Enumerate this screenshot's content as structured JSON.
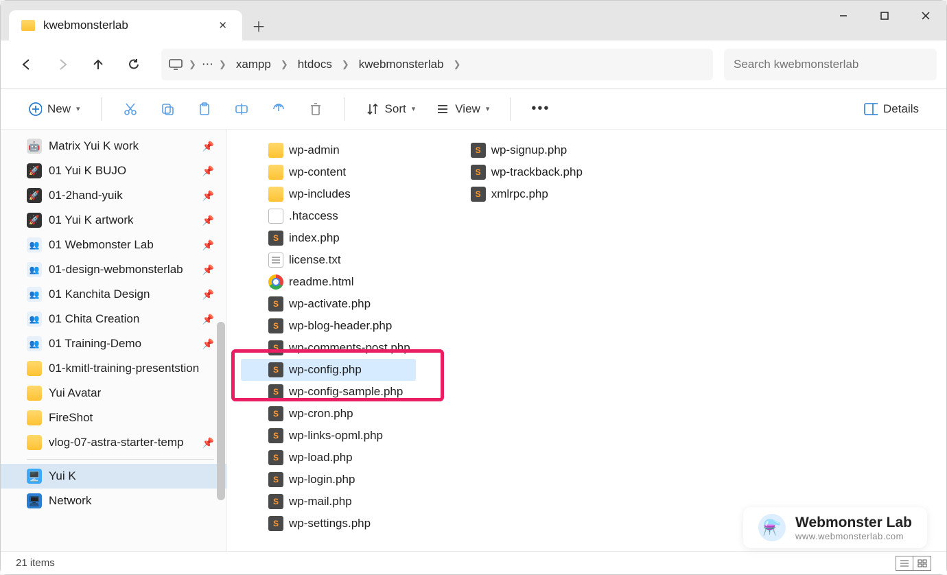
{
  "tab": {
    "title": "kwebmonsterlab"
  },
  "breadcrumb": {
    "segments": [
      "xampp",
      "htdocs",
      "kwebmonsterlab"
    ]
  },
  "search": {
    "placeholder": "Search kwebmonsterlab"
  },
  "toolbar": {
    "new_label": "New",
    "sort_label": "Sort",
    "view_label": "View",
    "details_label": "Details"
  },
  "sidebar": {
    "items": [
      {
        "label": "Matrix Yui K work",
        "icon": "robot",
        "pinned": true
      },
      {
        "label": "01 Yui K BUJO",
        "icon": "rocket",
        "pinned": true
      },
      {
        "label": "01-2hand-yuik",
        "icon": "rocket",
        "pinned": true
      },
      {
        "label": "01 Yui K artwork",
        "icon": "rocket",
        "pinned": true
      },
      {
        "label": "01 Webmonster Lab",
        "icon": "pal",
        "pinned": true
      },
      {
        "label": "01-design-webmonsterlab",
        "icon": "pal",
        "pinned": true
      },
      {
        "label": "01 Kanchita Design",
        "icon": "pal",
        "pinned": true
      },
      {
        "label": "01 Chita Creation",
        "icon": "pal",
        "pinned": true
      },
      {
        "label": "01 Training-Demo",
        "icon": "pal",
        "pinned": true
      },
      {
        "label": "01-kmitl-training-presentstion",
        "icon": "folder",
        "pinned": false
      },
      {
        "label": "Yui Avatar",
        "icon": "folder",
        "pinned": false
      },
      {
        "label": "FireShot",
        "icon": "folder",
        "pinned": false
      },
      {
        "label": "vlog-07-astra-starter-temp",
        "icon": "folder",
        "pinned": true
      }
    ],
    "bottom": [
      {
        "label": "Yui K",
        "icon": "pc",
        "active": true
      },
      {
        "label": "Network",
        "icon": "net",
        "active": false
      }
    ]
  },
  "files": {
    "col1": [
      {
        "name": "wp-admin",
        "type": "folder"
      },
      {
        "name": "wp-content",
        "type": "folder"
      },
      {
        "name": "wp-includes",
        "type": "folder"
      },
      {
        "name": ".htaccess",
        "type": "file"
      },
      {
        "name": "index.php",
        "type": "subl"
      },
      {
        "name": "license.txt",
        "type": "txt"
      },
      {
        "name": "readme.html",
        "type": "chrome"
      },
      {
        "name": "wp-activate.php",
        "type": "subl"
      },
      {
        "name": "wp-blog-header.php",
        "type": "subl"
      },
      {
        "name": "wp-comments-post.php",
        "type": "subl"
      },
      {
        "name": "wp-config.php",
        "type": "subl",
        "selected": true
      },
      {
        "name": "wp-config-sample.php",
        "type": "subl"
      },
      {
        "name": "wp-cron.php",
        "type": "subl"
      },
      {
        "name": "wp-links-opml.php",
        "type": "subl"
      },
      {
        "name": "wp-load.php",
        "type": "subl"
      },
      {
        "name": "wp-login.php",
        "type": "subl"
      },
      {
        "name": "wp-mail.php",
        "type": "subl"
      },
      {
        "name": "wp-settings.php",
        "type": "subl"
      }
    ],
    "col2": [
      {
        "name": "wp-signup.php",
        "type": "subl"
      },
      {
        "name": "wp-trackback.php",
        "type": "subl"
      },
      {
        "name": "xmlrpc.php",
        "type": "subl"
      }
    ]
  },
  "status": {
    "count": "21 items"
  },
  "watermark": {
    "title": "Webmonster Lab",
    "url": "www.webmonsterlab.com"
  }
}
